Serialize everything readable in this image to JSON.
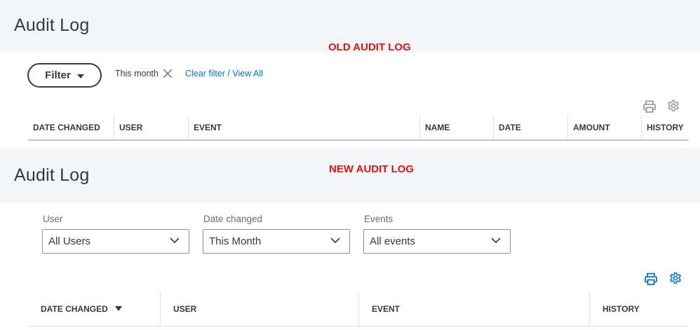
{
  "old_log": {
    "title": "Audit Log",
    "caption": "OLD AUDIT LOG",
    "filter_button": "Filter",
    "active_filter": "This month",
    "clear_link": "Clear filter / View All",
    "columns": [
      "DATE CHANGED",
      "USER",
      "EVENT",
      "NAME",
      "DATE",
      "AMOUNT",
      "HISTORY"
    ]
  },
  "new_log": {
    "title": "Audit Log",
    "caption": "NEW AUDIT LOG",
    "filters": [
      {
        "label": "User",
        "value": "All Users"
      },
      {
        "label": "Date changed",
        "value": "This Month"
      },
      {
        "label": "Events",
        "value": "All events"
      }
    ],
    "columns": [
      "DATE CHANGED",
      "USER",
      "EVENT",
      "HISTORY"
    ]
  },
  "colors": {
    "caption": "#e2120c",
    "link": "#0077c5",
    "band": "#f4f5f8",
    "icon_old": "#8d9096",
    "icon_new": "#0077c5"
  },
  "icons": {
    "print": "printer-icon",
    "settings": "gear-icon",
    "dropdown": "chevron-down-icon",
    "clear": "close-icon",
    "sort": "sort-descending-icon"
  }
}
